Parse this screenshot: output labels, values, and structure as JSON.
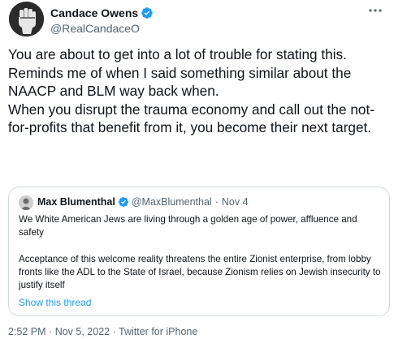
{
  "author": {
    "name": "Candace Owens",
    "handle": "@RealCandaceO"
  },
  "tweet": {
    "paragraphs": [
      "You are about to get into a lot of trouble for stating this.",
      "Reminds me of when I said something similar about the NAACP and BLM way back when.",
      "When you disrupt the trauma economy and call out the not-for-profits that benefit from it, you become their next target."
    ]
  },
  "quote": {
    "name": "Max Blumenthal",
    "handle": "@MaxBlumenthal",
    "separator": "·",
    "date": "Nov 4",
    "paragraphs": [
      "We White American Jews are living through a golden age of power, affluence and safety",
      "Acceptance of this welcome reality threatens the entire Zionist enterprise, from lobby fronts like the ADL to the State of Israel, because Zionism relies on Jewish insecurity to justify itself"
    ],
    "show_thread": "Show this thread"
  },
  "footer": {
    "time": "2:52 PM",
    "sep": "·",
    "date": "Nov 5, 2022",
    "source": "Twitter for iPhone"
  },
  "icons": {
    "verified": "verified-badge-icon",
    "more": "more-options-icon"
  },
  "colors": {
    "verified": "#1d9bf0",
    "link": "#1d9bf0",
    "secondary_text": "#536471",
    "border": "#cfd9de"
  }
}
